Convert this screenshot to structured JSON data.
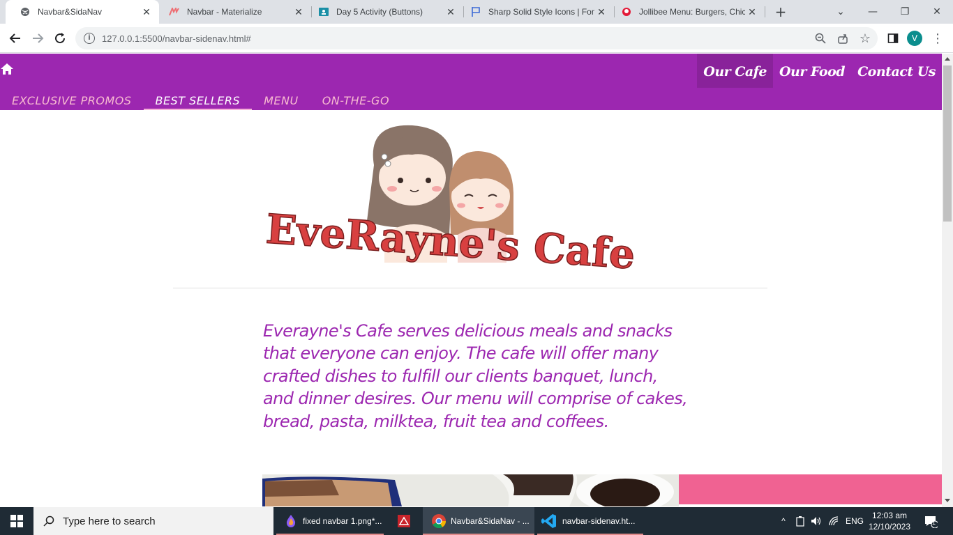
{
  "browser": {
    "tabs": [
      {
        "title": "Navbar&SidaNav",
        "active": true
      },
      {
        "title": "Navbar - Materialize",
        "active": false
      },
      {
        "title": "Day 5 Activity (Buttons)",
        "active": false
      },
      {
        "title": "Sharp Solid Style Icons | Fon",
        "active": false
      },
      {
        "title": "Jollibee Menu: Burgers, Chic",
        "active": false
      }
    ],
    "url": "127.0.0.1:5500/navbar-sidenav.html#",
    "profile_initial": "V"
  },
  "page": {
    "nav_right": [
      {
        "label": "Our Cafe",
        "active": true
      },
      {
        "label": "Our Food",
        "active": false
      },
      {
        "label": "Contact Us",
        "active": false
      }
    ],
    "tabs": [
      {
        "label": "Exclusive Promos",
        "active": false
      },
      {
        "label": "Best Sellers",
        "active": true
      },
      {
        "label": "Menu",
        "active": false
      },
      {
        "label": "On-The-Go",
        "active": false
      }
    ],
    "logo_text": "EveRayne's Cafe",
    "about_text": "Everayne's Cafe serves delicious meals and snacks that everyone can enjoy. The cafe will offer many crafted dishes to fulfill our clients banquet, lunch, and dinner desires. Our menu will comprise of cakes, bread, pasta, milktea, fruit tea and coffees."
  },
  "taskbar": {
    "search_placeholder": "Type here to search",
    "apps": [
      {
        "label": "fixed navbar 1.png*..."
      },
      {
        "label": ""
      },
      {
        "label": "Navbar&SidaNav - ..."
      },
      {
        "label": "navbar-sidenav.ht..."
      }
    ],
    "language": "ENG",
    "time": "12:03 am",
    "date": "12/10/2023",
    "notification_count": "1"
  },
  "colors": {
    "navbar": "#9c27b0",
    "accent_pink": "#f06292",
    "tab_inactive": "#f8bbd0",
    "logo_red": "#d84040"
  }
}
